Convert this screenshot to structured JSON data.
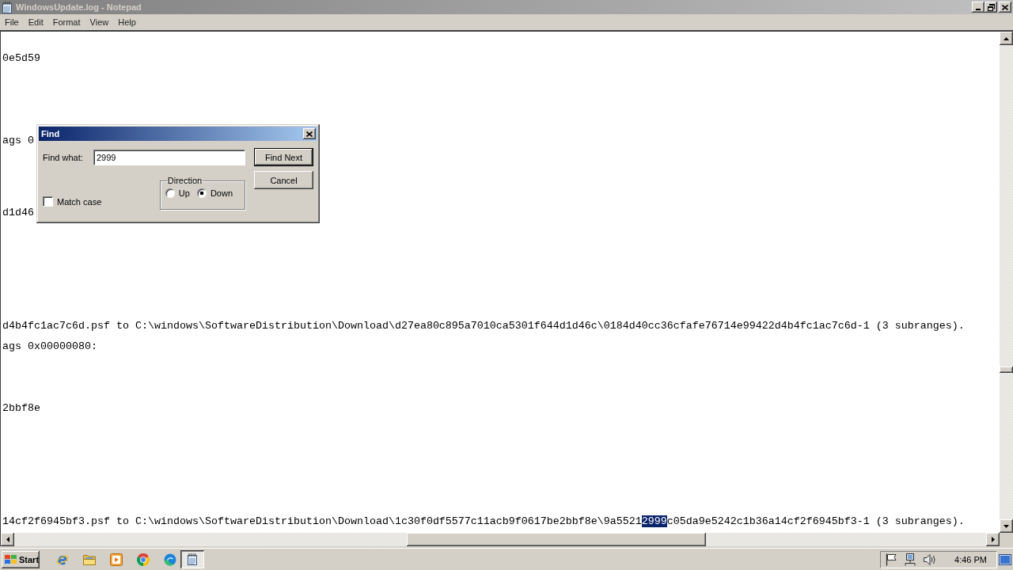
{
  "window": {
    "title": "WindowsUpdate.log - Notepad",
    "active": false
  },
  "menu": [
    {
      "label": "File"
    },
    {
      "label": "Edit"
    },
    {
      "label": "Format"
    },
    {
      "label": "View"
    },
    {
      "label": "Help"
    }
  ],
  "editor": {
    "lines": [
      {
        "segments": [
          {
            "text": "0e5d59",
            "selected": false
          }
        ]
      },
      {
        "segments": [
          {
            "text": "ags 0",
            "selected": false
          }
        ]
      },
      {
        "segments": [
          {
            "text": "d1d46",
            "selected": false
          }
        ]
      },
      {
        "segments": [
          {
            "text": "d4b4fc1ac7c6d.psf to C:\\windows\\SoftwareDistribution\\Download\\d27ea80c895a7010ca5301f644d1d46c\\0184d40cc36cfafe76714e99422d4b4fc1ac7c6d-1 (3 subranges).",
            "selected": false
          }
        ]
      },
      {
        "segments": [
          {
            "text": "ags 0x00000080:",
            "selected": false
          }
        ]
      },
      {
        "segments": [
          {
            "text": "2bbf8e",
            "selected": false
          }
        ]
      },
      {
        "segments": [
          {
            "text": "14cf2f6945bf3.psf to C:\\windows\\SoftwareDistribution\\Download\\1c30f0df5577c11acb9f0617be2bbf8e\\9a5521",
            "selected": false
          },
          {
            "text": "2999",
            "selected": true
          },
          {
            "text": "c05da9e5242c1b36a14cf2f6945bf3-1 (3 subranges).",
            "selected": false
          }
        ]
      }
    ]
  },
  "find_dialog": {
    "title": "Find",
    "active": true,
    "find_what": {
      "label": "Find what:",
      "value": "2999"
    },
    "buttons": [
      {
        "label": "Find Next",
        "default": true
      },
      {
        "label": "Cancel",
        "default": false
      }
    ],
    "match_case": {
      "label": "Match case",
      "checked": false
    },
    "direction": {
      "label": "Direction",
      "options": [
        {
          "label": "Up",
          "selected": false
        },
        {
          "label": "Down",
          "selected": true
        }
      ]
    }
  },
  "taskbar": {
    "start": "Start",
    "task_buttons": [
      {
        "selected": true
      }
    ],
    "clock": "4:46 PM"
  }
}
